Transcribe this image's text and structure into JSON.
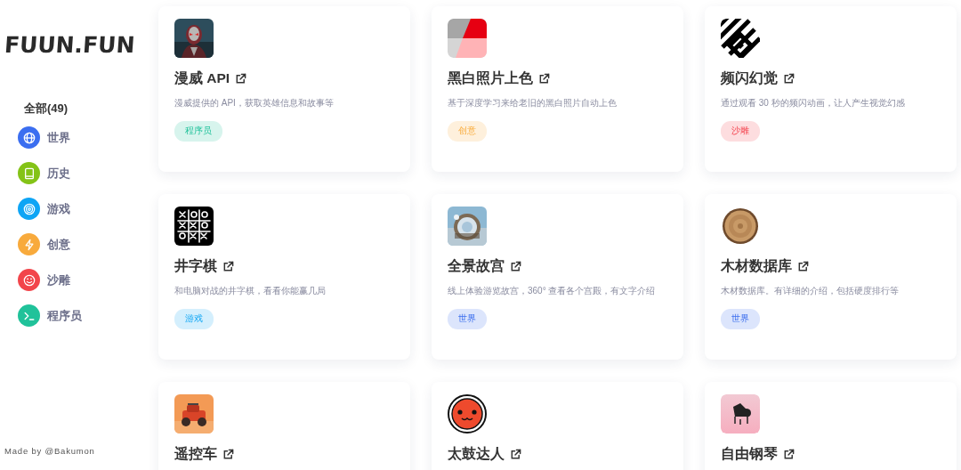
{
  "sidebar": {
    "logo": "FUUN.FUN",
    "all_label": "全部(49)",
    "items": [
      {
        "label": "世界",
        "color": "#3b6ef0"
      },
      {
        "label": "历史",
        "color": "#84c317"
      },
      {
        "label": "游戏",
        "color": "#0ea5f5"
      },
      {
        "label": "创意",
        "color": "#f8aa3c"
      },
      {
        "label": "沙雕",
        "color": "#f2454b"
      },
      {
        "label": "程序员",
        "color": "#20c29a"
      }
    ],
    "footer": "Made by @Bakumon"
  },
  "cards": [
    {
      "title": "漫威 API",
      "description": "漫威提供的 API，获取英雄信息和故事等",
      "tag": "程序员",
      "color": "#d7f4ed"
    },
    {
      "title": "黑白照片上色",
      "description": "基于深度学习来给老旧的黑白照片自动上色",
      "tag": "创意",
      "color": "#fef0dc"
    },
    {
      "title": "频闪幻觉",
      "description": "通过观看 30 秒的频闪动画，让人产生视觉幻感",
      "tag": "沙雕",
      "color": "#fddddf"
    },
    {
      "title": "井字棋",
      "description": "和电脑对战的井字棋，看看你能赢几局",
      "tag": "游戏",
      "color": "#d4effd"
    },
    {
      "title": "全景故宫",
      "description": "线上体验游览故宫，360° 查看各个宫殿，有文字介绍",
      "tag": "世界",
      "color": "#dce5fc"
    },
    {
      "title": "木材数据库",
      "description": "木材数据库。有详细的介绍，包括硬度排行等",
      "tag": "世界",
      "color": "#dce5fc"
    },
    {
      "title": "遥控车"
    },
    {
      "title": "太鼓达人"
    },
    {
      "title": "自由钢琴"
    }
  ]
}
